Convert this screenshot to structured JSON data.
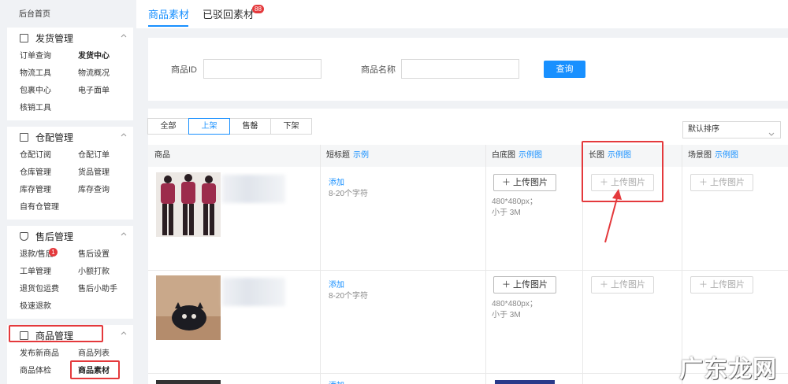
{
  "sidebar": {
    "home": "后台首页",
    "sections": [
      {
        "title": "发货管理",
        "icon": "document-icon",
        "items": [
          "订单查询",
          "发货中心",
          "物流工具",
          "物流概况",
          "包裹中心",
          "电子面单",
          "核销工具"
        ]
      },
      {
        "title": "仓配管理",
        "icon": "warehouse-icon",
        "items": [
          "仓配订阅",
          "仓配订单",
          "仓库管理",
          "货品管理",
          "库存管理",
          "库存查询",
          "自有仓管理"
        ]
      },
      {
        "title": "售后管理",
        "icon": "shield-icon",
        "items": [
          "退款/售后",
          "售后设置",
          "工单管理",
          "小额打款",
          "退货包运费",
          "售后小助手",
          "极速退款"
        ],
        "badge": "1"
      },
      {
        "title": "商品管理",
        "icon": "bag-icon",
        "items": [
          "发布新商品",
          "商品列表",
          "商品体检",
          "商品素材"
        ]
      }
    ]
  },
  "tabs": [
    {
      "label": "商品素材"
    },
    {
      "label": "已驳回素材",
      "badge": "88"
    }
  ],
  "filter": {
    "id_label": "商品ID",
    "name_label": "商品名称",
    "query_label": "查询"
  },
  "segments": [
    "全部",
    "上架",
    "售罄",
    "下架"
  ],
  "sort": {
    "value": "默认排序"
  },
  "table": {
    "col_product": "商品",
    "col_short": "短标题",
    "col_white": "白底图",
    "col_long": "长图",
    "col_scene": "场景图",
    "example": "示例",
    "example_img": "示例图"
  },
  "rows": [
    {
      "add": "添加",
      "hint": "8-20个字符",
      "upload": "上传图片",
      "spec1": "480*480px；",
      "spec2": "小于 3M"
    },
    {
      "add": "添加",
      "hint": "8-20个字符",
      "upload": "上传图片",
      "spec1": "480*480px；",
      "spec2": "小于 3M"
    },
    {
      "add": "添加"
    }
  ],
  "watermark": "广东龙网",
  "colors": {
    "accent": "#1890ff",
    "alert": "#e4393c"
  }
}
